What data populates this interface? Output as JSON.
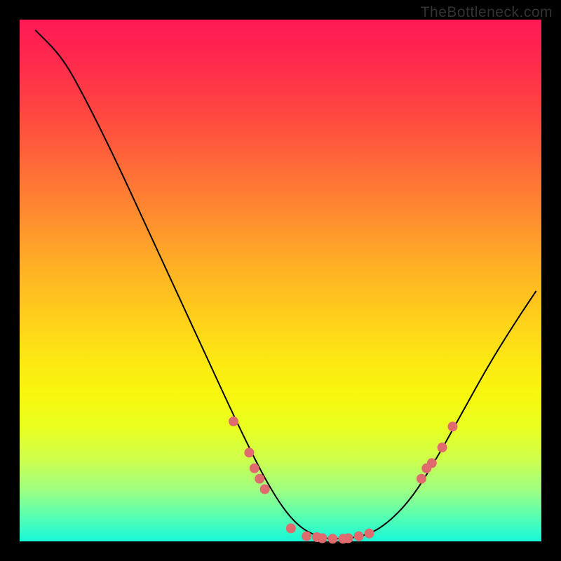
{
  "watermark": "TheBottleneck.com",
  "chart_data": {
    "type": "line",
    "title": "",
    "xlabel": "",
    "ylabel": "",
    "xlim": [
      0,
      100
    ],
    "ylim": [
      0,
      100
    ],
    "curve": [
      {
        "x": 3,
        "y": 98
      },
      {
        "x": 8,
        "y": 93
      },
      {
        "x": 12,
        "y": 86
      },
      {
        "x": 18,
        "y": 74
      },
      {
        "x": 24,
        "y": 61
      },
      {
        "x": 30,
        "y": 48
      },
      {
        "x": 36,
        "y": 35
      },
      {
        "x": 42,
        "y": 22
      },
      {
        "x": 48,
        "y": 10
      },
      {
        "x": 53,
        "y": 3
      },
      {
        "x": 58,
        "y": 0.5
      },
      {
        "x": 62,
        "y": 0.5
      },
      {
        "x": 66,
        "y": 1
      },
      {
        "x": 70,
        "y": 3
      },
      {
        "x": 75,
        "y": 8
      },
      {
        "x": 80,
        "y": 16
      },
      {
        "x": 85,
        "y": 25
      },
      {
        "x": 90,
        "y": 34
      },
      {
        "x": 95,
        "y": 42
      },
      {
        "x": 99,
        "y": 48
      }
    ],
    "points": [
      {
        "x": 41,
        "y": 23
      },
      {
        "x": 44,
        "y": 17
      },
      {
        "x": 45,
        "y": 14
      },
      {
        "x": 46,
        "y": 12
      },
      {
        "x": 47,
        "y": 10
      },
      {
        "x": 52,
        "y": 2.5
      },
      {
        "x": 55,
        "y": 1
      },
      {
        "x": 57,
        "y": 0.8
      },
      {
        "x": 58,
        "y": 0.6
      },
      {
        "x": 60,
        "y": 0.5
      },
      {
        "x": 62,
        "y": 0.5
      },
      {
        "x": 63,
        "y": 0.6
      },
      {
        "x": 65,
        "y": 1
      },
      {
        "x": 67,
        "y": 1.5
      },
      {
        "x": 77,
        "y": 12
      },
      {
        "x": 78,
        "y": 14
      },
      {
        "x": 79,
        "y": 15
      },
      {
        "x": 81,
        "y": 18
      },
      {
        "x": 83,
        "y": 22
      }
    ]
  }
}
